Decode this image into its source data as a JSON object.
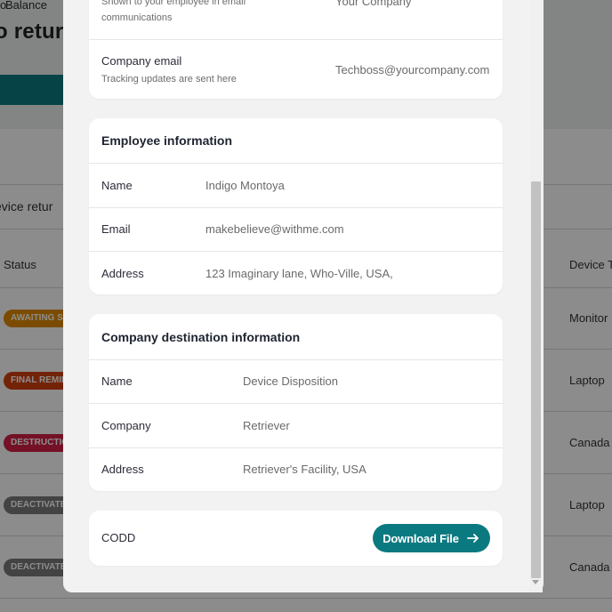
{
  "background": {
    "balance_label": "Balance",
    "heading": "o return",
    "device_returns": "evice retur",
    "table": {
      "col_status": "Status",
      "col_device": "Device T",
      "rows": [
        {
          "status": "AWAITING SH",
          "status_color": "#e08a00",
          "device": "Monitor"
        },
        {
          "status": "FINAL REMIN",
          "status_color": "#d2410f",
          "device": "Laptop"
        },
        {
          "status": "DESTRUCTIO",
          "status_color": "#d32045",
          "device": "Canada"
        },
        {
          "status": "DEACTIVATE",
          "status_color": "#7a7a7a",
          "device": "Laptop"
        },
        {
          "status": "DEACTIVATE",
          "status_color": "#7a7a7a",
          "device": "Canada"
        }
      ]
    }
  },
  "company_card": {
    "name_sub": "Shown to your employee in email",
    "name_sub2": "communications",
    "name_value": "Your Company",
    "email_label": "Company email",
    "email_sub": "Tracking updates are sent here",
    "email_value": "Techboss@yourcompany.com"
  },
  "employee_card": {
    "title": "Employee information",
    "rows": [
      {
        "label": "Name",
        "value": "Indigo Montoya"
      },
      {
        "label": "Email",
        "value": "makebelieve@withme.com"
      },
      {
        "label": "Address",
        "value": "123 Imaginary lane, Who-Ville, USA,"
      }
    ]
  },
  "destination_card": {
    "title": "Company destination information",
    "rows": [
      {
        "label": "Name",
        "value": "Device Disposition"
      },
      {
        "label": "Company",
        "value": "Retriever"
      },
      {
        "label": "Address",
        "value": "Retriever's Facility, USA"
      }
    ]
  },
  "codd_card": {
    "label": "CODD",
    "button_label": "Download File",
    "button_icon": "arrow-right-icon"
  },
  "colors": {
    "accent": "#0b7a80"
  }
}
